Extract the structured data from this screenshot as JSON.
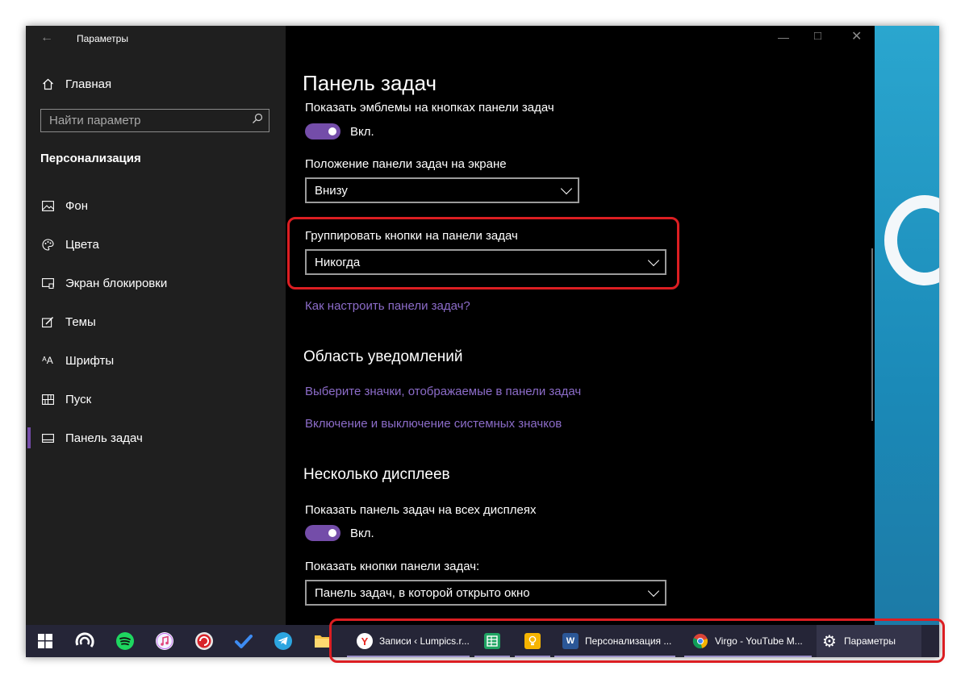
{
  "window": {
    "title": "Параметры"
  },
  "sidebar": {
    "home_label": "Главная",
    "search_placeholder": "Найти параметр",
    "section_title": "Персонализация",
    "items": [
      {
        "label": "Фон",
        "icon": "picture-icon"
      },
      {
        "label": "Цвета",
        "icon": "palette-icon"
      },
      {
        "label": "Экран блокировки",
        "icon": "lock-screen-icon"
      },
      {
        "label": "Темы",
        "icon": "themes-icon"
      },
      {
        "label": "Шрифты",
        "icon": "fonts-icon"
      },
      {
        "label": "Пуск",
        "icon": "start-icon"
      },
      {
        "label": "Панель задач",
        "icon": "taskbar-icon",
        "selected": true
      }
    ]
  },
  "main": {
    "page_title": "Панель задач",
    "badges": {
      "label": "Показать эмблемы на кнопках панели задач",
      "toggle_state": "Вкл."
    },
    "position": {
      "label": "Положение панели задач на экране",
      "value": "Внизу"
    },
    "grouping": {
      "label": "Группировать кнопки на панели задач",
      "value": "Никогда"
    },
    "help_link": "Как настроить панели задач?",
    "notification_area": {
      "heading": "Область уведомлений",
      "link1": "Выберите значки, отображаемые в панели задач",
      "link2": "Включение и выключение системных значков"
    },
    "multi_display": {
      "heading": "Несколько дисплеев",
      "show_all_label": "Показать панель задач на всех дисплеях",
      "toggle_state": "Вкл.",
      "buttons_label": "Показать кнопки панели задач:",
      "buttons_value": "Панель задач, в которой открыто окно"
    }
  },
  "taskbar": {
    "pinned": [
      "windows-start-icon",
      "edge-like-icon",
      "spotify-icon",
      "itunes-icon",
      "lumpics-icon",
      "todo-icon",
      "telegram-icon",
      "explorer-icon"
    ],
    "apps": [
      {
        "label": "Записи ‹ Lumpics.r...",
        "icon": "yandex-browser-icon"
      },
      {
        "label": "",
        "icon": "sheets-icon"
      },
      {
        "label": "",
        "icon": "keep-icon"
      },
      {
        "label": "Персонализация ...",
        "icon": "word-icon"
      },
      {
        "label": "Virgo - YouTube M...",
        "icon": "chrome-icon"
      },
      {
        "label": "Параметры",
        "icon": "settings-gear-icon"
      }
    ]
  },
  "colors": {
    "accent": "#744da9",
    "link": "#8c6cc9",
    "highlight": "#dc1e22",
    "taskbar": "#252537"
  }
}
